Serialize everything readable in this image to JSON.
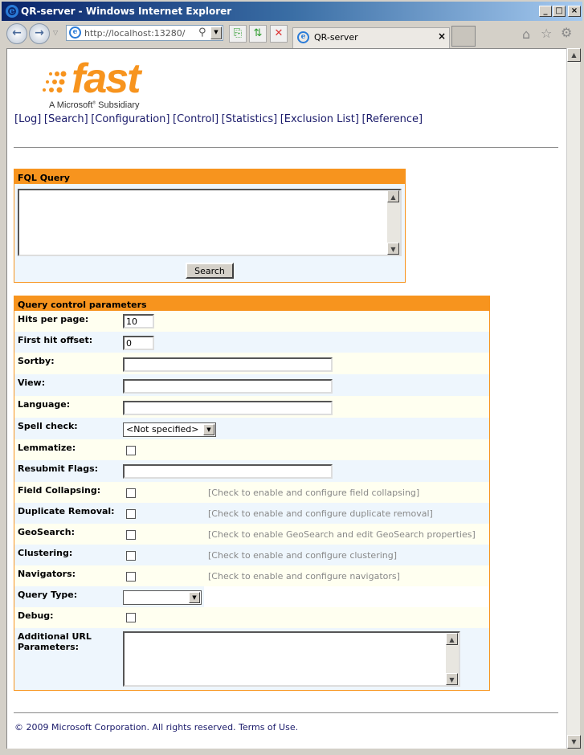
{
  "window": {
    "title": "QR-server - Windows Internet Explorer"
  },
  "browser": {
    "address": "http://localhost:13280/",
    "tab_title": "QR-server"
  },
  "logo": {
    "text": "fast",
    "subtitle": "A Microsoft Subsidiary",
    "color": "#f7941e"
  },
  "nav": [
    "[Log]",
    "[Search]",
    "[Configuration]",
    "[Control]",
    "[Statistics]",
    "[Exclusion List]",
    "[Reference]"
  ],
  "fql": {
    "title": "FQL Query",
    "value": "",
    "search_label": "Search"
  },
  "params": {
    "title": "Query control parameters",
    "hits_per_page": {
      "label": "Hits per page:",
      "value": "10"
    },
    "first_hit_offset": {
      "label": "First hit offset:",
      "value": "0"
    },
    "sortby": {
      "label": "Sortby:",
      "value": ""
    },
    "view": {
      "label": "View:",
      "value": ""
    },
    "language": {
      "label": "Language:",
      "value": ""
    },
    "spell_check": {
      "label": "Spell check:",
      "value": "<Not specified>"
    },
    "lemmatize": {
      "label": "Lemmatize:",
      "checked": false
    },
    "resubmit_flags": {
      "label": "Resubmit Flags:",
      "value": ""
    },
    "field_collapsing": {
      "label": "Field Collapsing:",
      "hint": "[Check to enable and configure field collapsing]",
      "checked": false
    },
    "duplicate_removal": {
      "label": "Duplicate Removal:",
      "hint": "[Check to enable and configure duplicate removal]",
      "checked": false
    },
    "geosearch": {
      "label": "GeoSearch:",
      "hint": "[Check to enable GeoSearch and edit GeoSearch properties]",
      "checked": false
    },
    "clustering": {
      "label": "Clustering:",
      "hint": "[Check to enable and configure clustering]",
      "checked": false
    },
    "navigators": {
      "label": "Navigators:",
      "hint": "[Check to enable and configure navigators]",
      "checked": false
    },
    "query_type": {
      "label": "Query Type:",
      "value": ""
    },
    "debug": {
      "label": "Debug:",
      "checked": false
    },
    "additional_url": {
      "label": "Additional URL Parameters:",
      "value": ""
    }
  },
  "footer": {
    "text": "© 2009 Microsoft Corporation. All rights reserved. Terms of Use."
  }
}
